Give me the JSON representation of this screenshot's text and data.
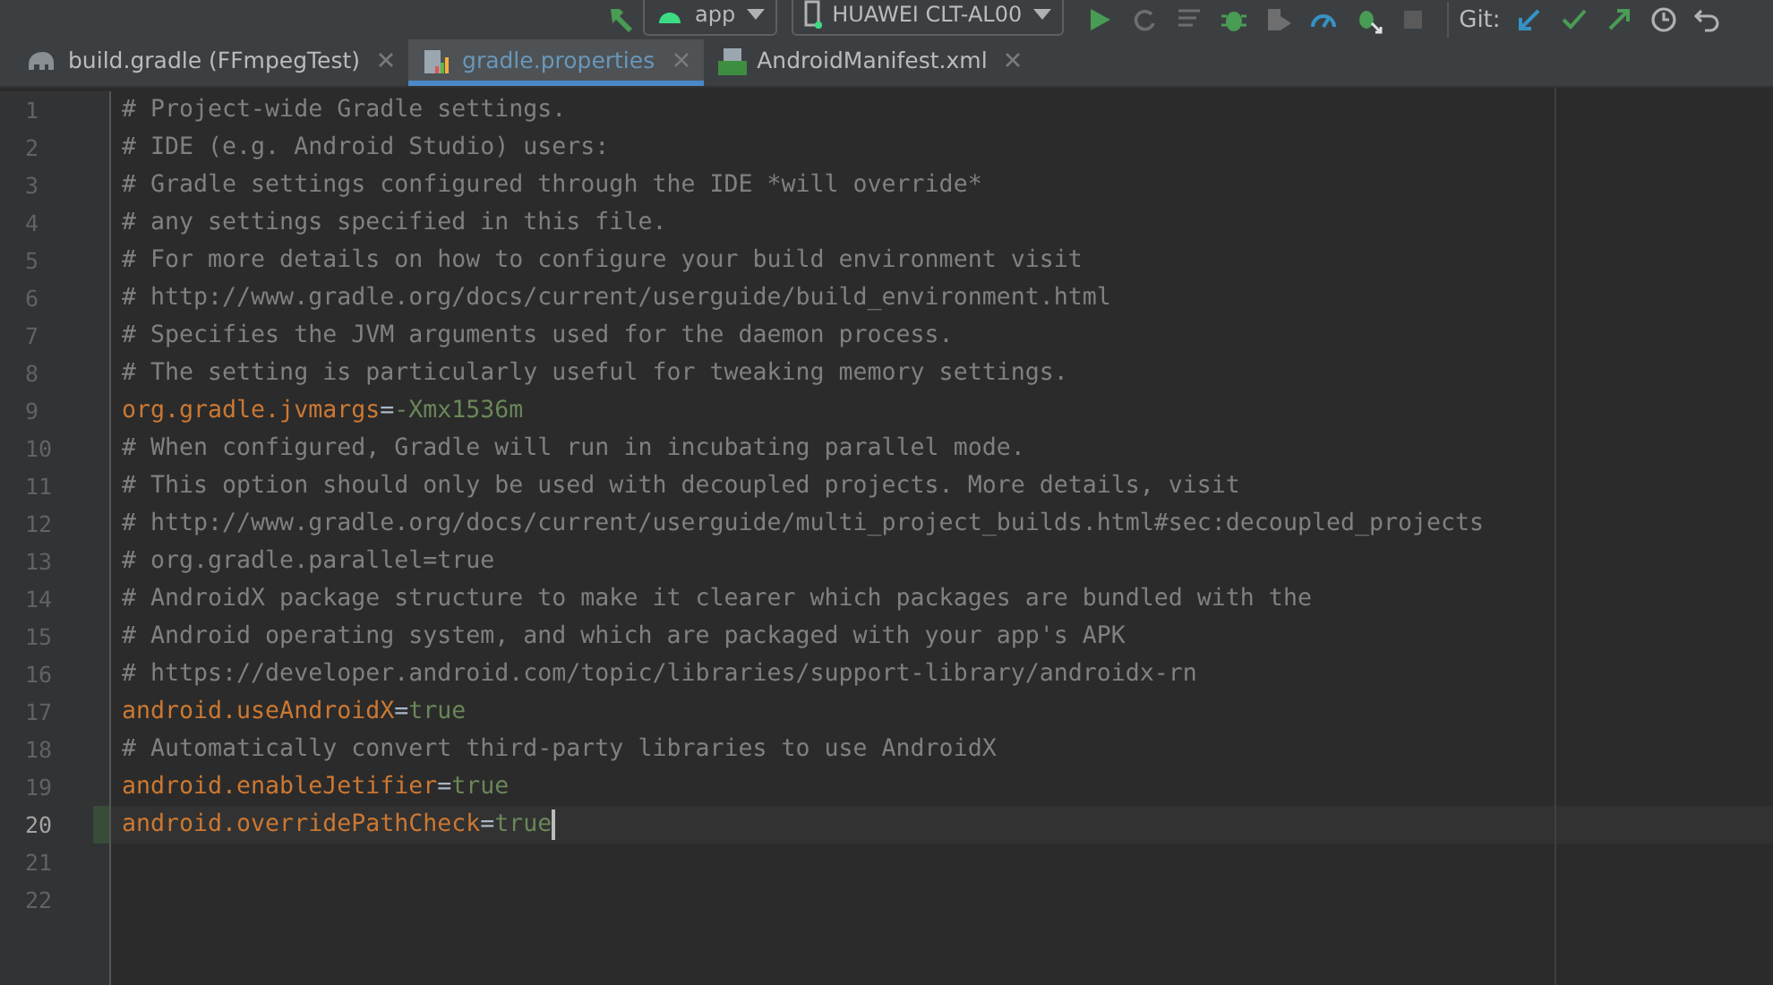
{
  "toolbar": {
    "run_config": "app",
    "device": "HUAWEI CLT-AL00",
    "git_label": "Git:"
  },
  "tabs": [
    {
      "label": "build.gradle (FFmpegTest)",
      "kind": "gradle",
      "selected": false
    },
    {
      "label": "gradle.properties",
      "kind": "properties",
      "selected": true
    },
    {
      "label": "AndroidManifest.xml",
      "kind": "manifest",
      "selected": false
    }
  ],
  "editor": {
    "lines": [
      {
        "number": "1",
        "kind": "comment",
        "text": "# Project-wide Gradle settings.",
        "current": false,
        "changed": false
      },
      {
        "number": "2",
        "kind": "comment",
        "text": "# IDE (e.g. Android Studio) users:",
        "current": false,
        "changed": false
      },
      {
        "number": "3",
        "kind": "comment",
        "text": "# Gradle settings configured through the IDE *will override*",
        "current": false,
        "changed": false
      },
      {
        "number": "4",
        "kind": "comment",
        "text": "# any settings specified in this file.",
        "current": false,
        "changed": false
      },
      {
        "number": "5",
        "kind": "comment",
        "text": "# For more details on how to configure your build environment visit",
        "current": false,
        "changed": false
      },
      {
        "number": "6",
        "kind": "comment",
        "text": "# http://www.gradle.org/docs/current/userguide/build_environment.html",
        "current": false,
        "changed": false
      },
      {
        "number": "7",
        "kind": "comment",
        "text": "# Specifies the JVM arguments used for the daemon process.",
        "current": false,
        "changed": false
      },
      {
        "number": "8",
        "kind": "comment",
        "text": "# The setting is particularly useful for tweaking memory settings.",
        "current": false,
        "changed": false
      },
      {
        "number": "9",
        "kind": "property",
        "key": "org.gradle.jvmargs",
        "sep": "=",
        "value": "-Xmx1536m",
        "current": false,
        "changed": false
      },
      {
        "number": "10",
        "kind": "comment",
        "text": "# When configured, Gradle will run in incubating parallel mode.",
        "current": false,
        "changed": false
      },
      {
        "number": "11",
        "kind": "comment",
        "text": "# This option should only be used with decoupled projects. More details, visit",
        "current": false,
        "changed": false
      },
      {
        "number": "12",
        "kind": "comment",
        "text": "# http://www.gradle.org/docs/current/userguide/multi_project_builds.html#sec:decoupled_projects",
        "current": false,
        "changed": false
      },
      {
        "number": "13",
        "kind": "comment",
        "text": "# org.gradle.parallel=true",
        "current": false,
        "changed": false
      },
      {
        "number": "14",
        "kind": "comment",
        "text": "# AndroidX package structure to make it clearer which packages are bundled with the",
        "current": false,
        "changed": false
      },
      {
        "number": "15",
        "kind": "comment",
        "text": "# Android operating system, and which are packaged with your app's APK",
        "current": false,
        "changed": false
      },
      {
        "number": "16",
        "kind": "comment",
        "text": "# https://developer.android.com/topic/libraries/support-library/androidx-rn",
        "current": false,
        "changed": false
      },
      {
        "number": "17",
        "kind": "property",
        "key": "android.useAndroidX",
        "sep": "=",
        "value": "true",
        "current": false,
        "changed": false
      },
      {
        "number": "18",
        "kind": "comment",
        "text": "# Automatically convert third-party libraries to use AndroidX",
        "current": false,
        "changed": false
      },
      {
        "number": "19",
        "kind": "property",
        "key": "android.enableJetifier",
        "sep": "=",
        "value": "true",
        "current": false,
        "changed": false
      },
      {
        "number": "20",
        "kind": "property",
        "key": "android.overridePathCheck",
        "sep": "=",
        "value": "true",
        "current": true,
        "changed": true
      },
      {
        "number": "21",
        "kind": "empty",
        "current": false,
        "changed": false
      },
      {
        "number": "22",
        "kind": "empty",
        "current": false,
        "changed": false
      }
    ]
  }
}
